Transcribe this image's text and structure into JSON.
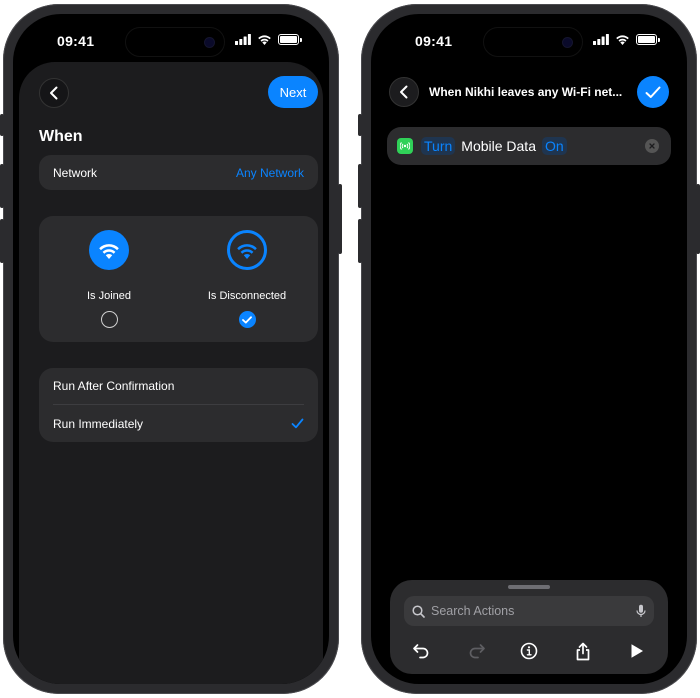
{
  "status": {
    "time": "09:41"
  },
  "left": {
    "next_label": "Next",
    "section_title": "When",
    "network": {
      "label": "Network",
      "value": "Any Network"
    },
    "wifi_options": [
      {
        "label": "Is Joined",
        "selected": false
      },
      {
        "label": "Is Disconnected",
        "selected": true
      }
    ],
    "run_options": [
      {
        "label": "Run After Confirmation",
        "checked": false
      },
      {
        "label": "Run Immediately",
        "checked": true
      }
    ]
  },
  "right": {
    "title": "When Nikhi leaves any Wi-Fi net...",
    "action": {
      "verb": "Turn",
      "object": "Mobile Data",
      "state": "On"
    },
    "search": {
      "placeholder": "Search Actions"
    },
    "colors": {
      "accent": "#0a84ff",
      "app_icon": "#30d158"
    }
  }
}
